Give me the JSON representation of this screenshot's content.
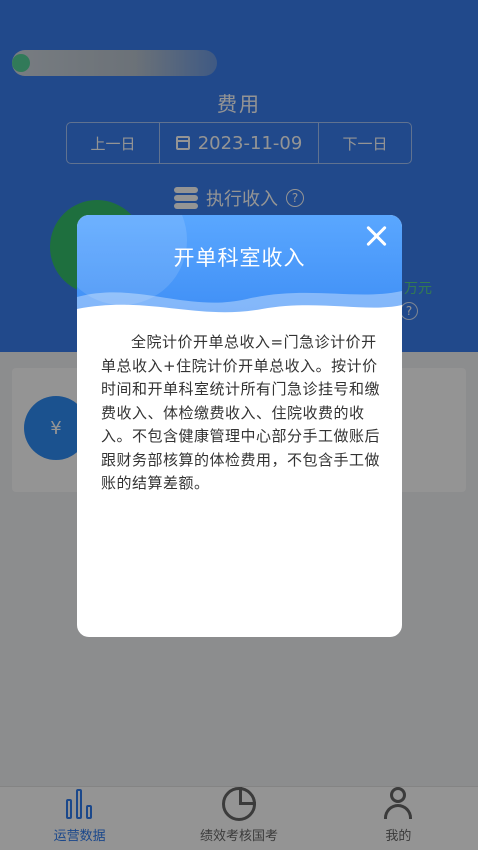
{
  "header": {
    "title": "费用",
    "prev_label": "上一日",
    "date": "2023-11-09",
    "next_label": "下一日",
    "section_title": "执行收入",
    "help_mark": "?",
    "unit_text": "万元"
  },
  "tabbar": {
    "tabs": [
      {
        "label": "运营数据",
        "icon": "bar-chart-icon"
      },
      {
        "label": "绩效考核国考",
        "icon": "pie-chart-icon"
      },
      {
        "label": "我的",
        "icon": "user-icon"
      }
    ],
    "active_index": 0
  },
  "modal": {
    "title": "开单科室收入",
    "body": "全院计价开单总收入=门急诊计价开单总收入+住院计价开单总收入。按计价时间和开单科室统计所有门急诊挂号和缴费收入、体检缴费收入、住院收费的收入。不包含健康管理中心部分手工做账后跟财务部核算的体检费用，不包含手工做账的结算差额。"
  },
  "card": {
    "icon_text": "¥"
  },
  "colors": {
    "header_blue": "#3a7ff0",
    "active_tab": "#2f7cf0",
    "green": "#35c06b"
  }
}
